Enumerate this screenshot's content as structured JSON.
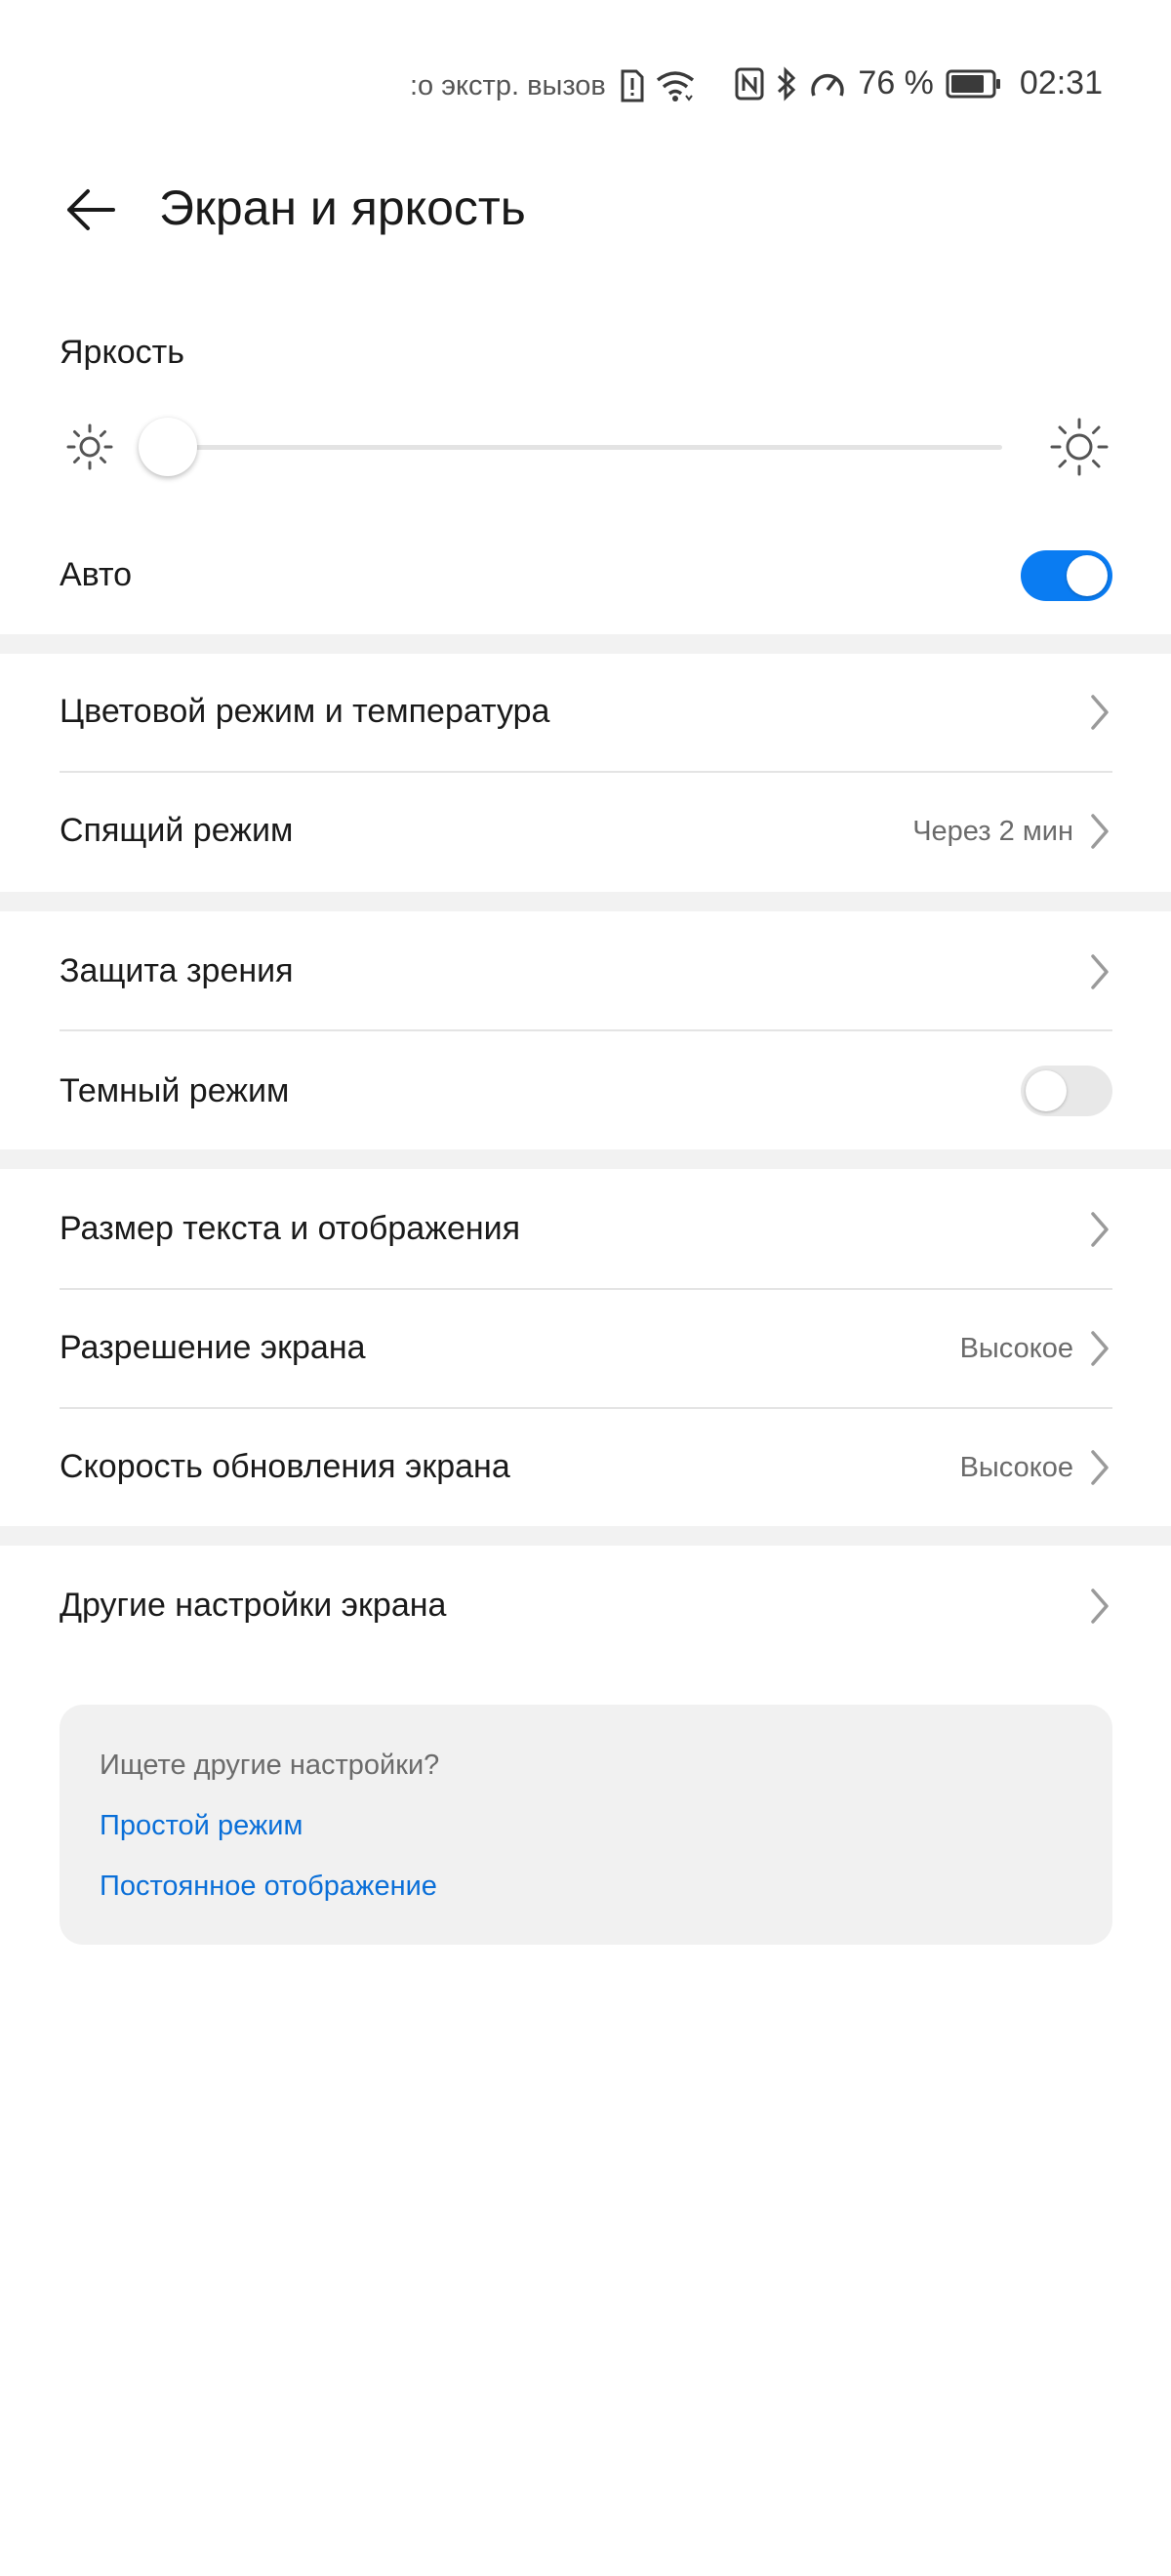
{
  "status_bar": {
    "emergency_text": ":о экстр. вызов",
    "battery_percent": "76 %",
    "time": "02:31",
    "icons": [
      "sim-alert-icon",
      "wifi-icon",
      "nfc-icon",
      "bluetooth-icon",
      "speedometer-icon",
      "battery-icon"
    ]
  },
  "header": {
    "title": "Экран и яркость",
    "back_icon": "arrow-left-icon"
  },
  "brightness": {
    "label": "Яркость",
    "level": 0.0
  },
  "auto": {
    "label": "Авто",
    "enabled": true
  },
  "items": {
    "color_mode": {
      "label": "Цветовой режим и температура"
    },
    "sleep": {
      "label": "Спящий режим",
      "value": "Через 2 мин"
    },
    "eye_comfort": {
      "label": "Защита зрения"
    },
    "dark_mode": {
      "label": "Темный режим",
      "enabled": false
    },
    "text_size": {
      "label": "Размер текста и отображения"
    },
    "resolution": {
      "label": "Разрешение экрана",
      "value": "Высокое"
    },
    "refresh_rate": {
      "label": "Скорость обновления экрана",
      "value": "Высокое"
    },
    "more_settings": {
      "label": "Другие настройки экрана"
    }
  },
  "suggestions": {
    "question": "Ищете другие настройки?",
    "links": [
      "Простой режим",
      "Постоянное отображение"
    ]
  },
  "colors": {
    "accent": "#0a7cf2",
    "link": "#0a6fd8",
    "toggle_off": "#e8e8e8",
    "section_gap": "#f2f2f2"
  }
}
